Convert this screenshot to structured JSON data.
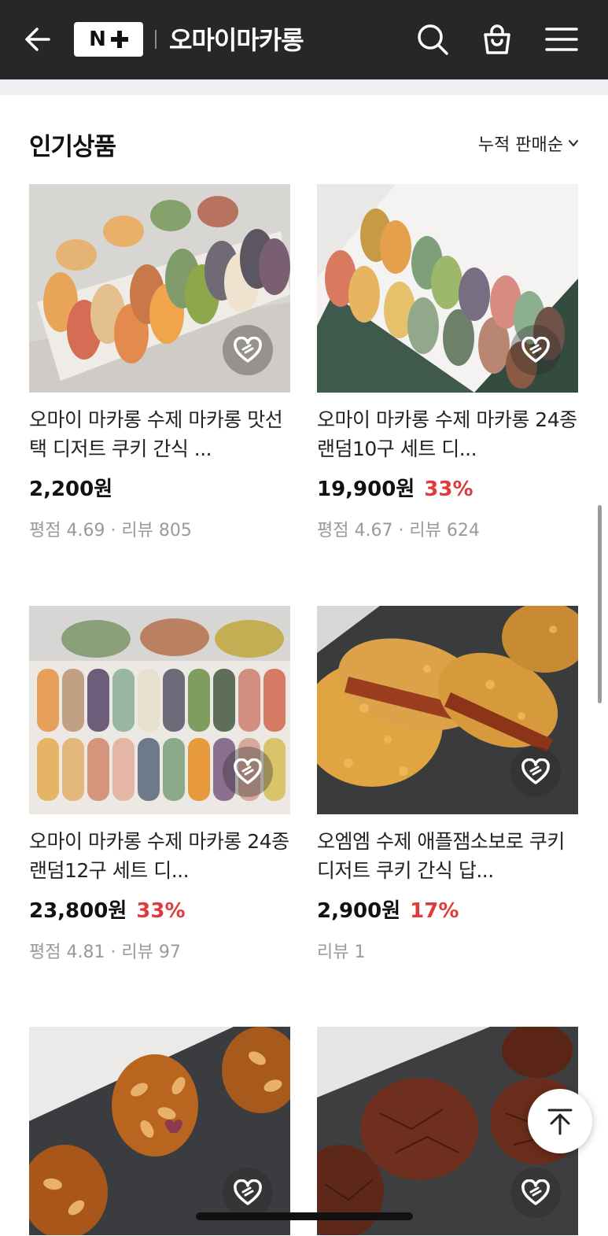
{
  "header": {
    "logo_text": "N",
    "store_name": "오마이마카롱",
    "icons": [
      "back-arrow-icon",
      "search-icon",
      "shopping-bag-icon",
      "hamburger-menu-icon"
    ]
  },
  "section": {
    "title": "인기상품",
    "sort_label": "누적 판매순"
  },
  "products": [
    {
      "name": "오마이 마카롱 수제 마카롱 맛선택 디저트 쿠키 간식 ...",
      "price": "2,200원",
      "discount": "",
      "meta": "평점 4.69 · 리뷰 805",
      "image": "macarons-on-tray"
    },
    {
      "name": "오마이 마카롱 수제 마카롱 24종 랜덤10구 세트 디...",
      "price": "19,900원",
      "discount": "33%",
      "meta": "평점 4.67 · 리뷰 624",
      "image": "macarons-in-box"
    },
    {
      "name": "오마이 마카롱 수제 마카롱 24종 랜덤12구 세트 디...",
      "price": "23,800원",
      "discount": "33%",
      "meta": "평점 4.81 · 리뷰 97",
      "image": "macarons-assortment"
    },
    {
      "name": "오엠엠 수제 애플잼소보로 쿠키 디저트 쿠키 간식 답...",
      "price": "2,900원",
      "discount": "17%",
      "meta": "리뷰 1",
      "image": "apple-jam-crumble-cookies"
    },
    {
      "name": "",
      "price": "",
      "discount": "",
      "meta": "",
      "image": "almond-florentine-cookies"
    },
    {
      "name": "",
      "price": "",
      "discount": "",
      "meta": "",
      "image": "chocolate-brownie-cookies"
    }
  ],
  "colors": {
    "header_bg": "#262729",
    "discount": "#e0393e",
    "meta": "#9a9a9a"
  }
}
